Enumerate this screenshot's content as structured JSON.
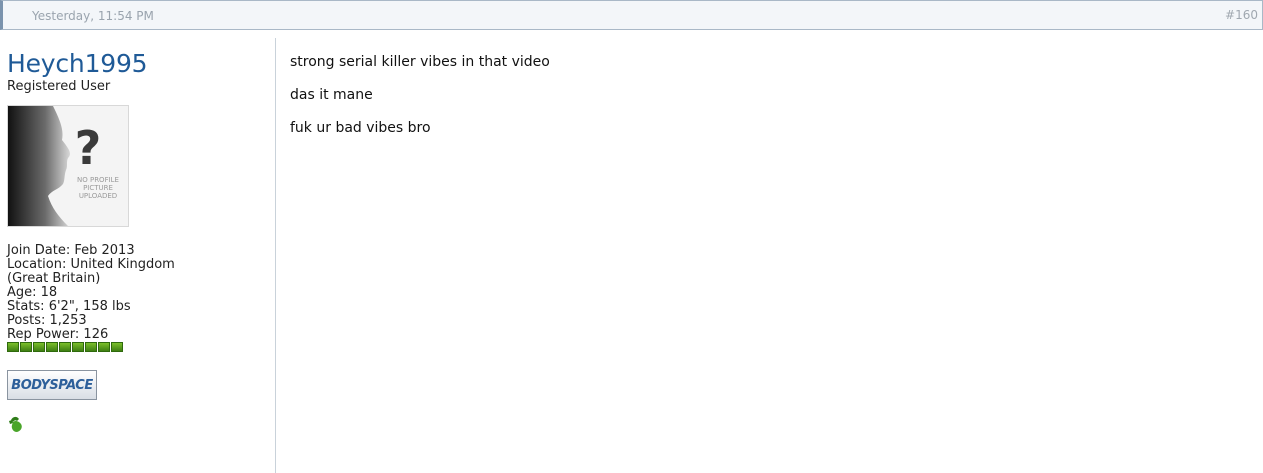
{
  "post": {
    "date": "Yesterday, 11:54 PM",
    "number": "#160"
  },
  "user": {
    "name": "Heych1995",
    "title": "Registered User",
    "avatar_text": "NO PROFILE PICTURE UPLOADED",
    "join_date": "Join Date: Feb 2013",
    "location_line1": "Location: United Kingdom",
    "location_line2": "(Great Britain)",
    "age": "Age: 18",
    "stats": "Stats: 6'2\", 158 lbs",
    "posts": "Posts: 1,253",
    "rep_power": "Rep Power: 126",
    "rep_pips": 9,
    "bodyspace_label": "BODYSPACE"
  },
  "message": {
    "lines": [
      "strong serial killer vibes in that video",
      "das it mane",
      "fuk ur bad vibes bro"
    ]
  },
  "colors": {
    "username": "#1f5a97",
    "rep_green": "#3e7f12"
  }
}
